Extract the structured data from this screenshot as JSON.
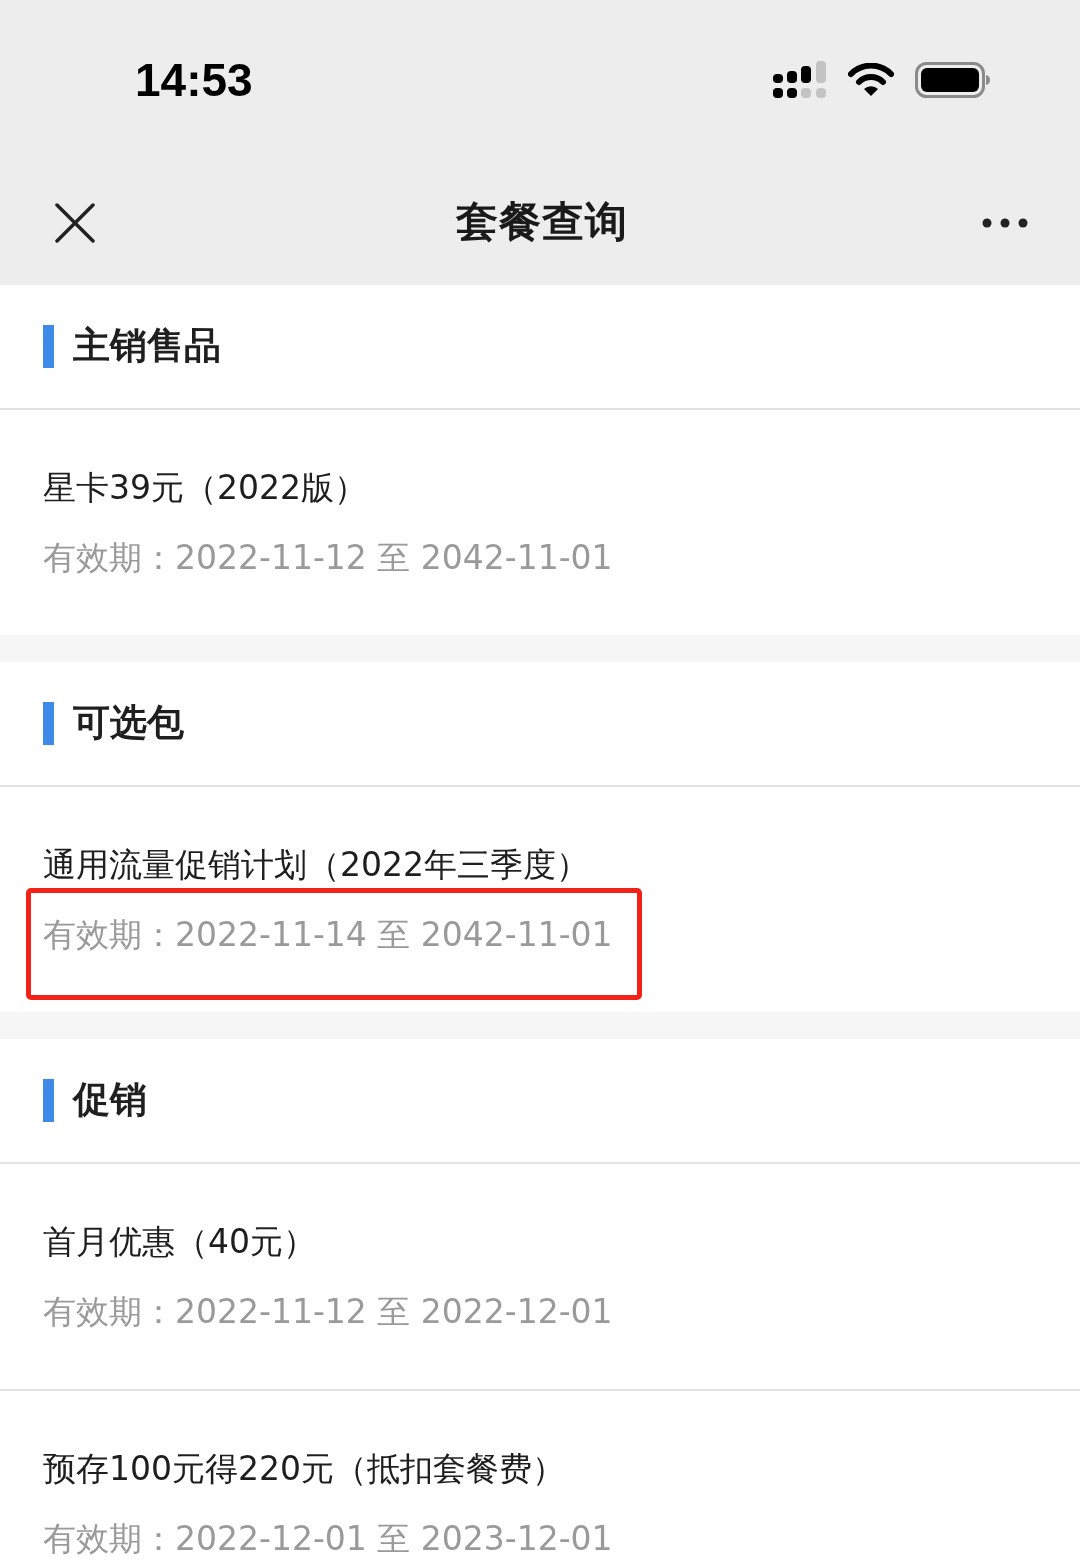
{
  "status_bar": {
    "time": "14:53"
  },
  "nav_bar": {
    "title": "套餐查询"
  },
  "sections": [
    {
      "title": "主销售品",
      "items": [
        {
          "name": "星卡39元（2022版）",
          "validity": "有效期：2022-11-12 至 2042-11-01",
          "highlighted": false
        }
      ]
    },
    {
      "title": "可选包",
      "items": [
        {
          "name": "通用流量促销计划（2022年三季度）",
          "validity": "有效期：2022-11-14 至 2042-11-01",
          "highlighted": true
        }
      ]
    },
    {
      "title": "促销",
      "items": [
        {
          "name": "首月优惠（40元）",
          "validity": "有效期：2022-11-12 至 2022-12-01",
          "highlighted": false
        },
        {
          "name": "预存100元得220元（抵扣套餐费）",
          "validity": "有效期：2022-12-01 至 2023-12-01",
          "highlighted": false
        }
      ]
    }
  ]
}
